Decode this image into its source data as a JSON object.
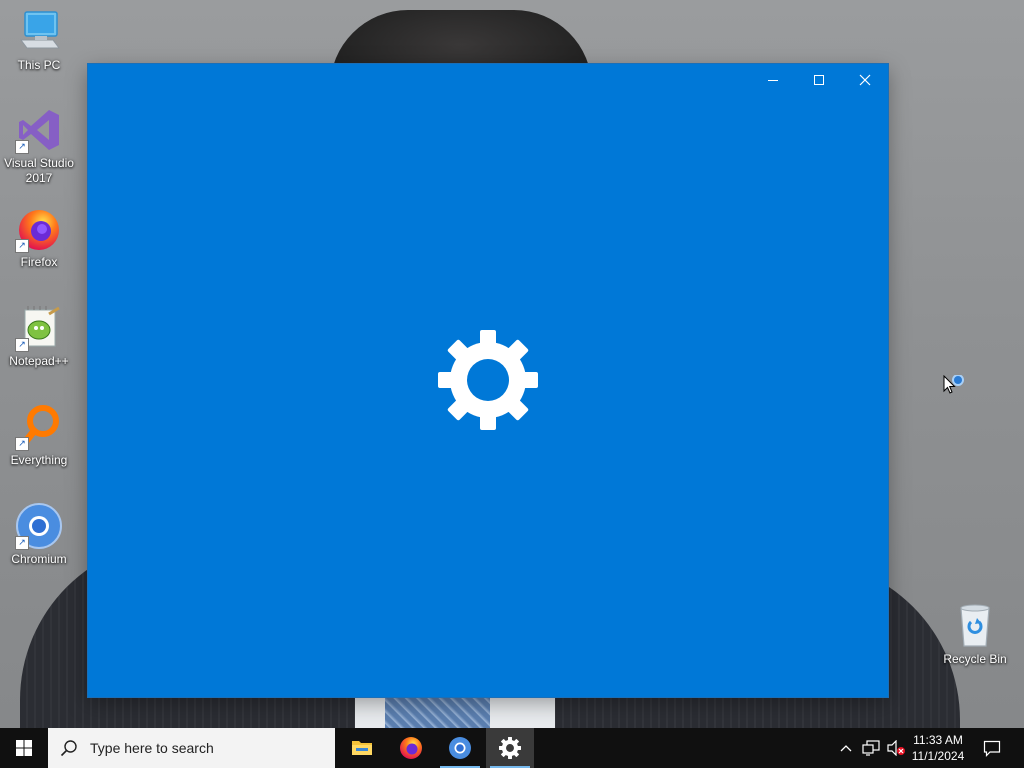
{
  "desktop": {
    "icons": [
      {
        "id": "this-pc",
        "label": "This PC",
        "shortcut": false
      },
      {
        "id": "visual-studio",
        "label": "Visual Studio 2017",
        "shortcut": true
      },
      {
        "id": "firefox",
        "label": "Firefox",
        "shortcut": true
      },
      {
        "id": "notepadpp",
        "label": "Notepad++",
        "shortcut": true
      },
      {
        "id": "everything",
        "label": "Everything",
        "shortcut": true
      },
      {
        "id": "chromium",
        "label": "Chromium",
        "shortcut": true
      },
      {
        "id": "recycle-bin",
        "label": "Recycle Bin",
        "shortcut": false
      }
    ]
  },
  "window": {
    "background": "#0078d7",
    "controls": {
      "minimize": "minimize-icon",
      "maximize": "maximize-icon",
      "close": "close-icon"
    },
    "splash_icon": "gear-icon"
  },
  "taskbar": {
    "search_placeholder": "Type here to search",
    "apps": [
      {
        "id": "file-explorer",
        "icon": "folder-icon",
        "running": false,
        "active": false
      },
      {
        "id": "firefox",
        "icon": "firefox-icon",
        "running": false,
        "active": false
      },
      {
        "id": "chromium",
        "icon": "chromium-icon",
        "running": true,
        "active": false
      },
      {
        "id": "settings",
        "icon": "gear-icon",
        "running": true,
        "active": true
      }
    ],
    "tray": {
      "icons": [
        "chevron-up-icon",
        "network-icon",
        "volume-muted-icon",
        "notification-icon"
      ]
    },
    "clock": {
      "time": "11:33 AM",
      "date": "11/1/2024"
    }
  },
  "colors": {
    "accent": "#0078d7",
    "taskbar": "#101010",
    "running_indicator": "#76b9ed"
  }
}
